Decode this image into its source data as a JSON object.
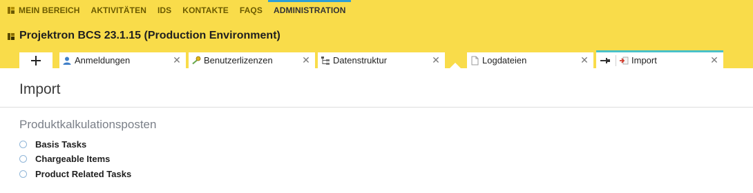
{
  "nav": {
    "items": [
      {
        "label": "MEIN BEREICH"
      },
      {
        "label": "AKTIVITÄTEN"
      },
      {
        "label": "IDS"
      },
      {
        "label": "KONTAKTE"
      },
      {
        "label": "FAQS"
      },
      {
        "label": "ADMINISTRATION",
        "active": true
      }
    ]
  },
  "environment": {
    "title": "Projektron BCS 23.1.15 (Production Environment)"
  },
  "tabs": {
    "add_label": "+",
    "items": [
      {
        "label": "Anmeldungen",
        "icon": "user-icon",
        "close": "✕"
      },
      {
        "label": "Benutzerlizenzen",
        "icon": "key-icon",
        "close": "✕"
      },
      {
        "label": "Datenstruktur",
        "icon": "tree-structure-icon",
        "close": "✕"
      },
      {
        "label": "Logdateien",
        "icon": "document-icon",
        "close": "✕"
      },
      {
        "label": "Import",
        "icon": "import-icon",
        "close": "✕",
        "active": true,
        "pin": "pin-icon"
      }
    ]
  },
  "page": {
    "title": "Import",
    "section_title": "Produktkalkulationsposten",
    "options": [
      {
        "label": "Basis Tasks"
      },
      {
        "label": "Chargeable Items"
      },
      {
        "label": "Product Related Tasks"
      }
    ]
  },
  "colors": {
    "header_bg": "#f9dc4a",
    "active_nav_indicator": "#2e9fd7",
    "active_tab_indicator": "#48c1c9"
  }
}
